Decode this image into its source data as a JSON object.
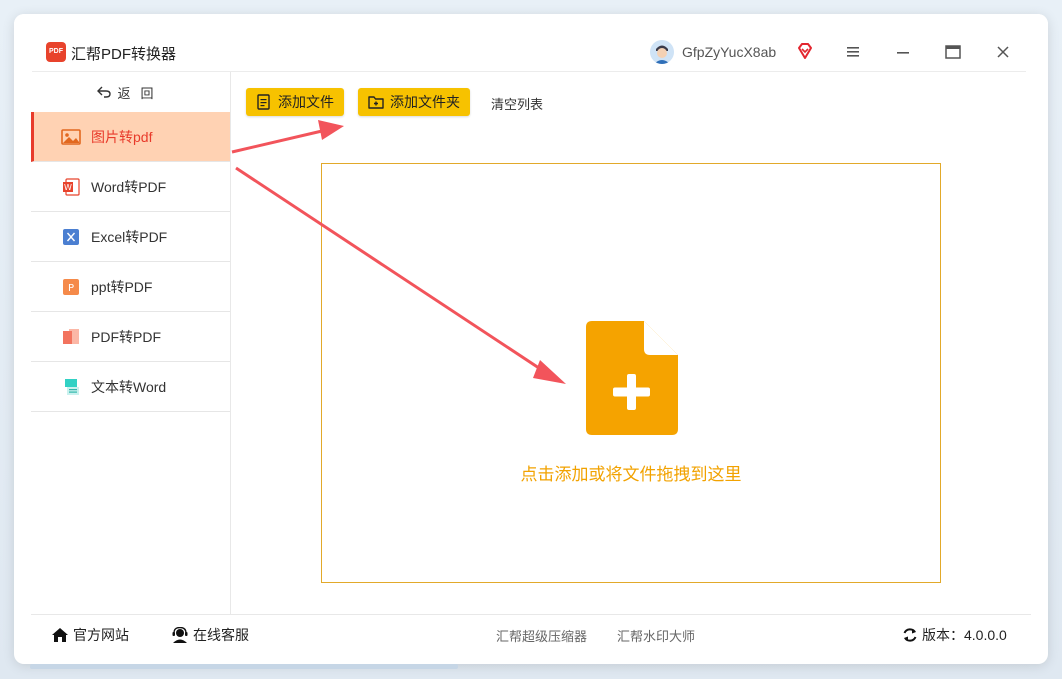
{
  "app": {
    "title": "汇帮PDF转换器",
    "logo_text": "PDF",
    "username": "GfpZyYucX8ab"
  },
  "sidebar": {
    "back_label": "返回",
    "items": [
      {
        "label": "图片转pdf",
        "icon": "image-icon",
        "active": true
      },
      {
        "label": "Word转PDF",
        "icon": "word-icon",
        "active": false
      },
      {
        "label": "Excel转PDF",
        "icon": "excel-icon",
        "active": false
      },
      {
        "label": "ppt转PDF",
        "icon": "ppt-icon",
        "active": false
      },
      {
        "label": "PDF转PDF",
        "icon": "pdf-icon",
        "active": false
      },
      {
        "label": "文本转Word",
        "icon": "text-icon",
        "active": false
      }
    ]
  },
  "toolbar": {
    "add_file": "添加文件",
    "add_folder": "添加文件夹",
    "clear_list": "清空列表"
  },
  "dropzone": {
    "text": "点击添加或将文件拖拽到这里"
  },
  "footer": {
    "website": "官方网站",
    "support": "在线客服",
    "link1": "汇帮超级压缩器",
    "link2": "汇帮水印大师",
    "version": "版本：4.0.0.0"
  },
  "colors": {
    "accent_yellow": "#f7c200",
    "active_bg": "#ffd2b3",
    "active_text": "#e83b2b",
    "drop_icon": "#f5a300",
    "arrow": "#f2545b"
  }
}
